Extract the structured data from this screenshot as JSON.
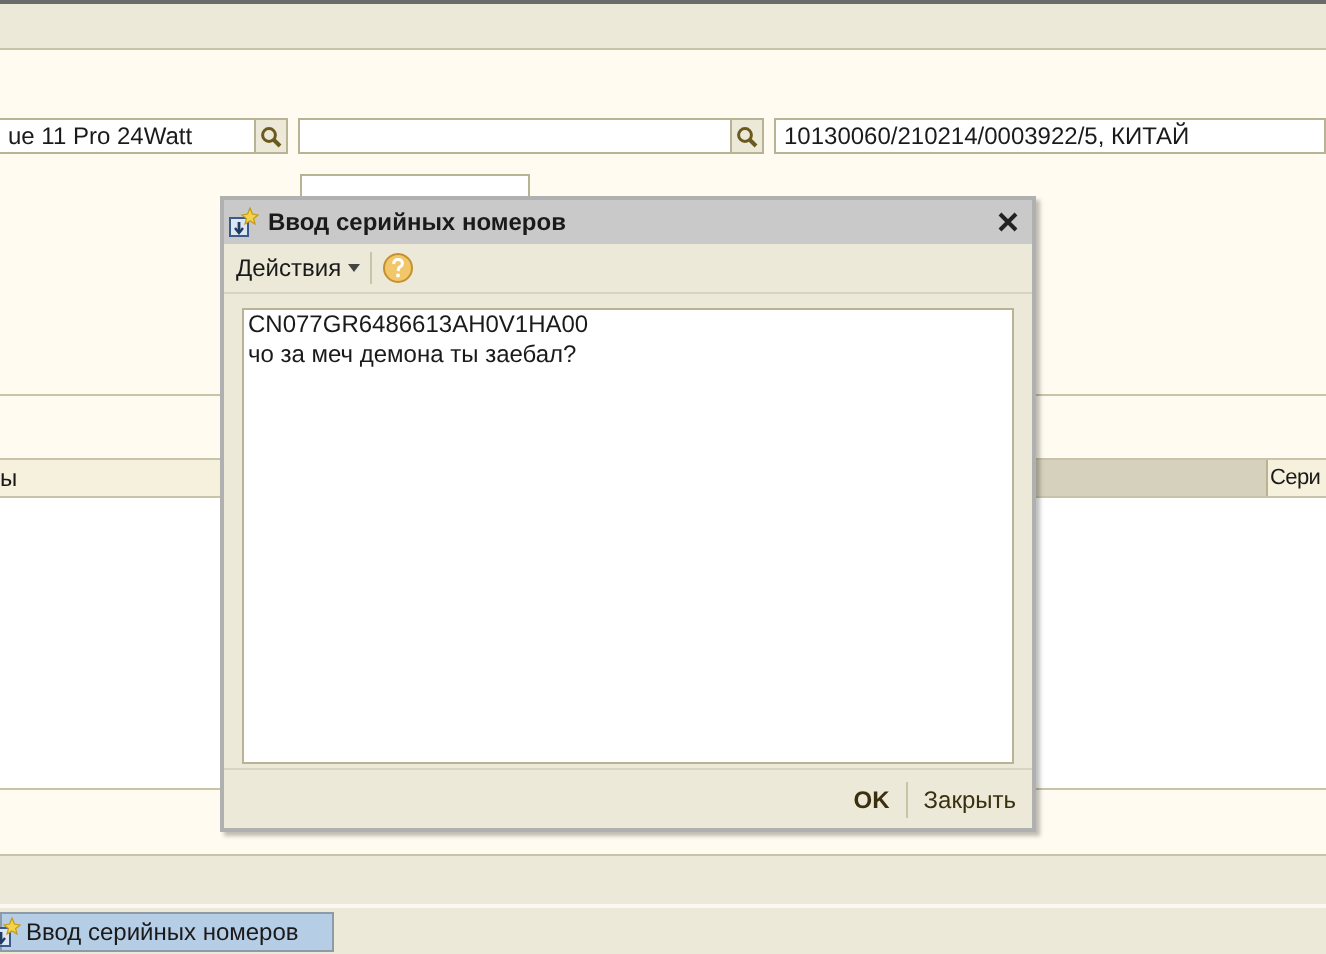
{
  "form": {
    "fields": [
      {
        "kind": "lookup",
        "value": "ue 11 Pro 24Watt"
      },
      {
        "kind": "lookup"
      },
      {
        "kind": "text",
        "value": "10130060/210214/0003922/5, КИТАЙ"
      }
    ],
    "table": {
      "columns": [
        {
          "label": "ы"
        },
        {
          "label": "Сери"
        }
      ]
    }
  },
  "dialog": {
    "title": "Ввод серийных номеров",
    "menu": "Действия",
    "text": "CN077GR6486613AH0V1HA00\nчо за меч демона ты заебал?",
    "buttons": [
      {
        "label": "OK",
        "default": true
      },
      {
        "label": "Закрыть",
        "default": false
      }
    ]
  },
  "taskbar": [
    {
      "label": "Ввод серийных номеров",
      "selected": true
    }
  ]
}
